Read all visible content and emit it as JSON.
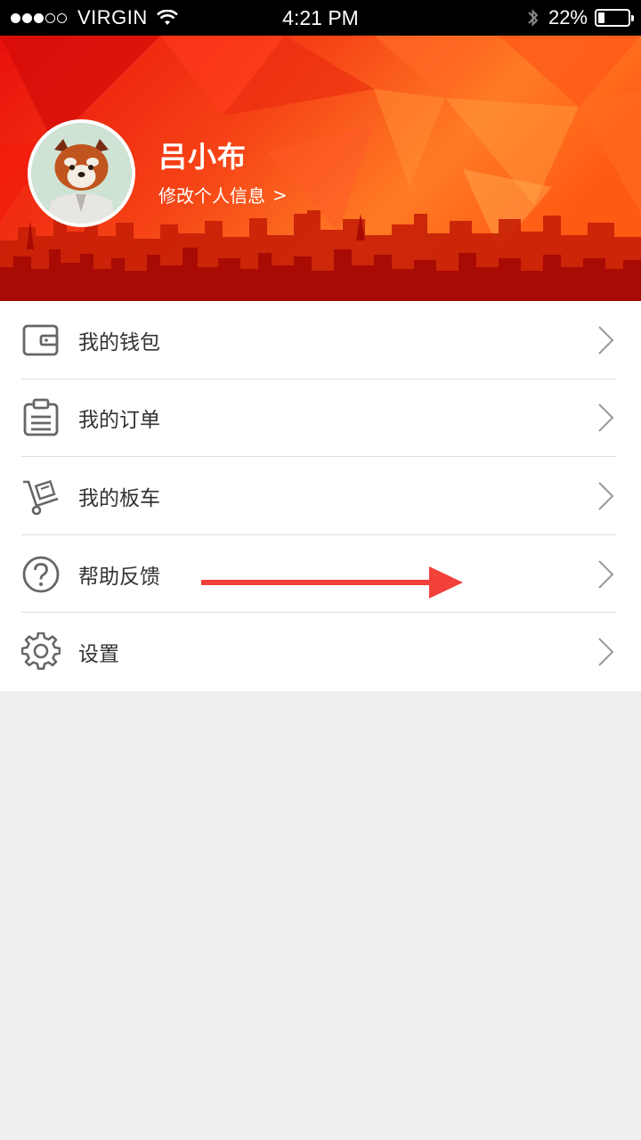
{
  "status_bar": {
    "signal_bars": 3,
    "signal_total": 5,
    "carrier": "VIRGIN",
    "wifi_icon": "wifi-icon",
    "time": "4:21 PM",
    "bluetooth_icon": "bluetooth-icon",
    "battery_percent": "22%",
    "battery_level": 0.22
  },
  "profile": {
    "name": "吕小布",
    "edit_label": "修改个人信息",
    "edit_arrow": ">",
    "avatar_icon": "red-panda-avatar"
  },
  "menu": {
    "items": [
      {
        "label": "我的钱包",
        "icon": "wallet-icon"
      },
      {
        "label": "我的订单",
        "icon": "clipboard-icon"
      },
      {
        "label": "我的板车",
        "icon": "hand-truck-icon"
      },
      {
        "label": "帮助反馈",
        "icon": "help-icon"
      },
      {
        "label": "设置",
        "icon": "gear-icon"
      }
    ]
  },
  "colors": {
    "header_red": "#f03a10",
    "header_orange": "#ff8a2a",
    "skyline": "#a80a04",
    "annotation_arrow": "#f2403a",
    "icon_gray": "#666666",
    "chevron_gray": "#999999"
  }
}
